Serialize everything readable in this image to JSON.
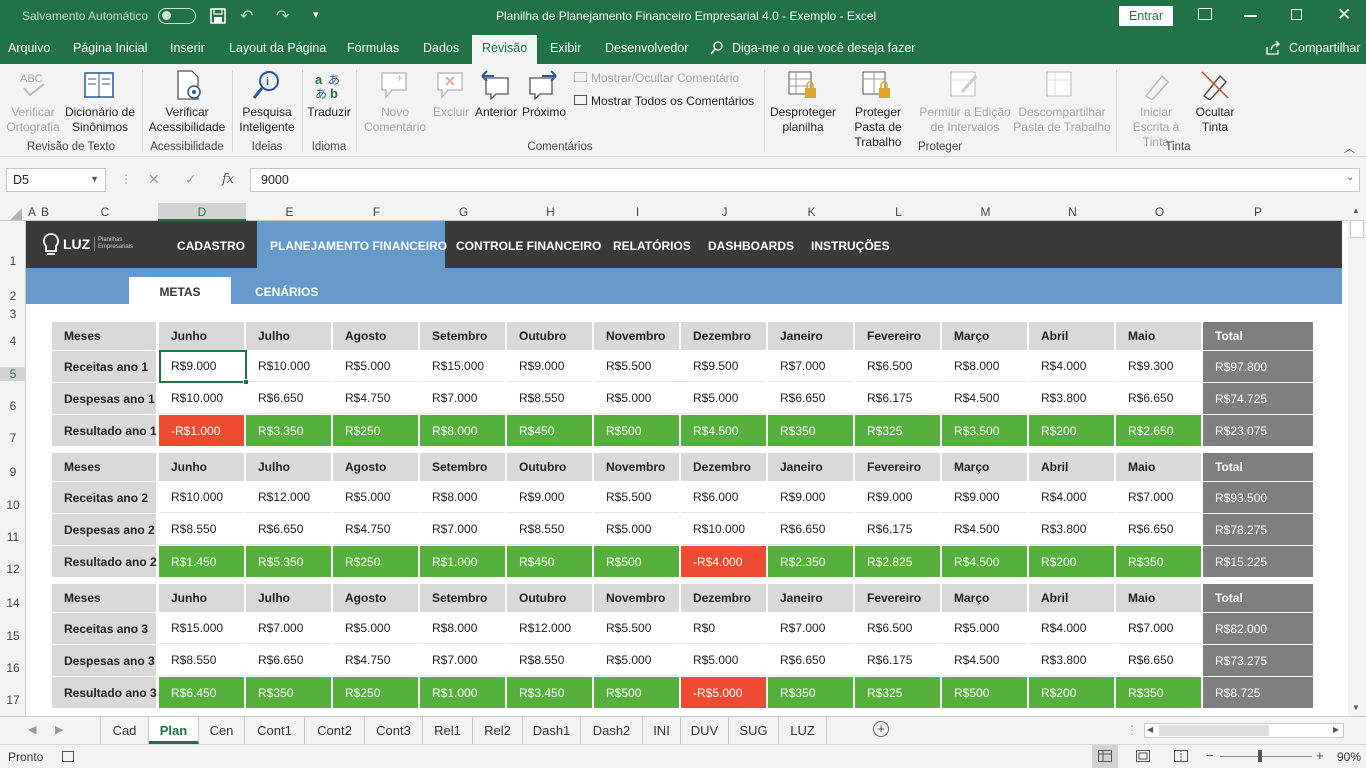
{
  "titlebar": {
    "autosave": "Salvamento Automático",
    "title": "Planilha de Planejamento Financeiro Empresarial 4.0 - Exemplo  -  Excel",
    "signin": "Entrar"
  },
  "ribbon_tabs": [
    "Arquivo",
    "Página Inicial",
    "Inserir",
    "Layout da Página",
    "Fórmulas",
    "Dados",
    "Revisão",
    "Exibir",
    "Desenvolvedor"
  ],
  "active_tab": "Revisão",
  "tell_me": "Diga-me o que você deseja fazer",
  "share": "Compartilhar",
  "ribbon": {
    "verificar_ortografia": "Verificar Ortografia",
    "dicionario": "Dicionário de Sinônimos",
    "verificar_acess": "Verificar Acessibilidade",
    "pesquisa": "Pesquisa Inteligente",
    "traduzir": "Traduzir",
    "novo_com": "Novo Comentário",
    "excluir": "Excluir",
    "anterior": "Anterior",
    "proximo": "Próximo",
    "mostrar_ocultar": "Mostrar/Ocultar Comentário",
    "mostrar_todos": "Mostrar Todos os Comentários",
    "desproteger": "Desproteger planilha",
    "proteger_pasta": "Proteger Pasta de Trabalho",
    "permitir": "Permitir a Edição de Intervalos",
    "descompartilhar": "Descompartilhar Pasta de Trabalho",
    "iniciar_escrita": "Iniciar Escrita à Tinta",
    "ocultar_tinta": "Ocultar Tinta",
    "groups": {
      "revisao": "Revisão de Texto",
      "acess": "Acessibilidade",
      "ideias": "Ideias",
      "idioma": "Idioma",
      "comentarios": "Comentários",
      "proteger": "Proteger",
      "tinta": "Tinta"
    }
  },
  "name_box": "D5",
  "formula": "9000",
  "columns": [
    "A",
    "B",
    "C",
    "D",
    "E",
    "F",
    "G",
    "H",
    "I",
    "J",
    "K",
    "L",
    "M",
    "N",
    "O",
    "P"
  ],
  "rows": [
    "1",
    "2",
    "3",
    "4",
    "5",
    "6",
    "7",
    "9",
    "10",
    "11",
    "12",
    "14",
    "15",
    "16",
    "17"
  ],
  "nav": {
    "logo": "LUZ",
    "logo_sub": "Planilhas Empresariais",
    "items": [
      "CADASTRO",
      "PLANEJAMENTO FINANCEIRO",
      "CONTROLE FINANCEIRO",
      "RELATÓRIOS",
      "DASHBOARDS",
      "INSTRUÇÕES"
    ],
    "sub": [
      "METAS",
      "CENÁRIOS"
    ]
  },
  "months": [
    "Junho",
    "Julho",
    "Agosto",
    "Setembro",
    "Outubro",
    "Novembro",
    "Dezembro",
    "Janeiro",
    "Fevereiro",
    "Março",
    "Abril",
    "Maio"
  ],
  "meses_label": "Meses",
  "total_label": "Total",
  "blocks": [
    {
      "rows": [
        {
          "label": "Receitas ano 1",
          "values": [
            "R$9.000",
            "R$10.000",
            "R$5.000",
            "R$15.000",
            "R$9.000",
            "R$5.500",
            "R$9.500",
            "R$7.000",
            "R$6.500",
            "R$8.000",
            "R$4.000",
            "R$9.300"
          ],
          "total": "R$97.800"
        },
        {
          "label": "Despesas ano 1",
          "values": [
            "R$10.000",
            "R$6.650",
            "R$4.750",
            "R$7.000",
            "R$8.550",
            "R$5.000",
            "R$5.000",
            "R$6.650",
            "R$6.175",
            "R$4.500",
            "R$3.800",
            "R$6.650"
          ],
          "total": "R$74.725"
        },
        {
          "label": "Resultado ano 1",
          "values": [
            "-R$1.000",
            "R$3.350",
            "R$250",
            "R$8.000",
            "R$450",
            "R$500",
            "R$4.500",
            "R$350",
            "R$325",
            "R$3.500",
            "R$200",
            "R$2.650"
          ],
          "total": "R$23.075"
        }
      ]
    },
    {
      "rows": [
        {
          "label": "Receitas ano 2",
          "values": [
            "R$10.000",
            "R$12.000",
            "R$5.000",
            "R$8.000",
            "R$9.000",
            "R$5.500",
            "R$6.000",
            "R$9.000",
            "R$9.000",
            "R$9.000",
            "R$4.000",
            "R$7.000"
          ],
          "total": "R$93.500"
        },
        {
          "label": "Despesas ano 2",
          "values": [
            "R$8.550",
            "R$6.650",
            "R$4.750",
            "R$7.000",
            "R$8.550",
            "R$5.000",
            "R$10.000",
            "R$6.650",
            "R$6.175",
            "R$4.500",
            "R$3.800",
            "R$6.650"
          ],
          "total": "R$78.275"
        },
        {
          "label": "Resultado ano 2",
          "values": [
            "R$1.450",
            "R$5.350",
            "R$250",
            "R$1.000",
            "R$450",
            "R$500",
            "-R$4.000",
            "R$2.350",
            "R$2.825",
            "R$4.500",
            "R$200",
            "R$350"
          ],
          "total": "R$15.225"
        }
      ]
    },
    {
      "rows": [
        {
          "label": "Receitas ano 3",
          "values": [
            "R$15.000",
            "R$7.000",
            "R$5.000",
            "R$8.000",
            "R$12.000",
            "R$5.500",
            "R$0",
            "R$7.000",
            "R$6.500",
            "R$5.000",
            "R$4.000",
            "R$7.000"
          ],
          "total": "R$82.000"
        },
        {
          "label": "Despesas ano 3",
          "values": [
            "R$8.550",
            "R$6.650",
            "R$4.750",
            "R$7.000",
            "R$8.550",
            "R$5.000",
            "R$5.000",
            "R$6.650",
            "R$6.175",
            "R$4.500",
            "R$3.800",
            "R$6.650"
          ],
          "total": "R$73.275"
        },
        {
          "label": "Resultado ano 3",
          "values": [
            "R$6.450",
            "R$350",
            "R$250",
            "R$1.000",
            "R$3.450",
            "R$500",
            "-R$5.000",
            "R$350",
            "R$325",
            "R$500",
            "R$200",
            "R$350"
          ],
          "total": "R$8.725"
        }
      ]
    }
  ],
  "sheet_tabs": [
    "Cad",
    "Plan",
    "Cen",
    "Cont1",
    "Cont2",
    "Cont3",
    "Rel1",
    "Rel2",
    "Dash1",
    "Dash2",
    "INI",
    "DUV",
    "SUG",
    "LUZ"
  ],
  "active_sheet": "Plan",
  "status": {
    "ready": "Pronto",
    "zoom": "90%"
  },
  "colors": {
    "green": "#217346",
    "positive": "#55b03c",
    "negative": "#ef4b33",
    "total": "#7f7f7f",
    "nav": "#3a3a3a",
    "subnav": "#6699cc"
  }
}
